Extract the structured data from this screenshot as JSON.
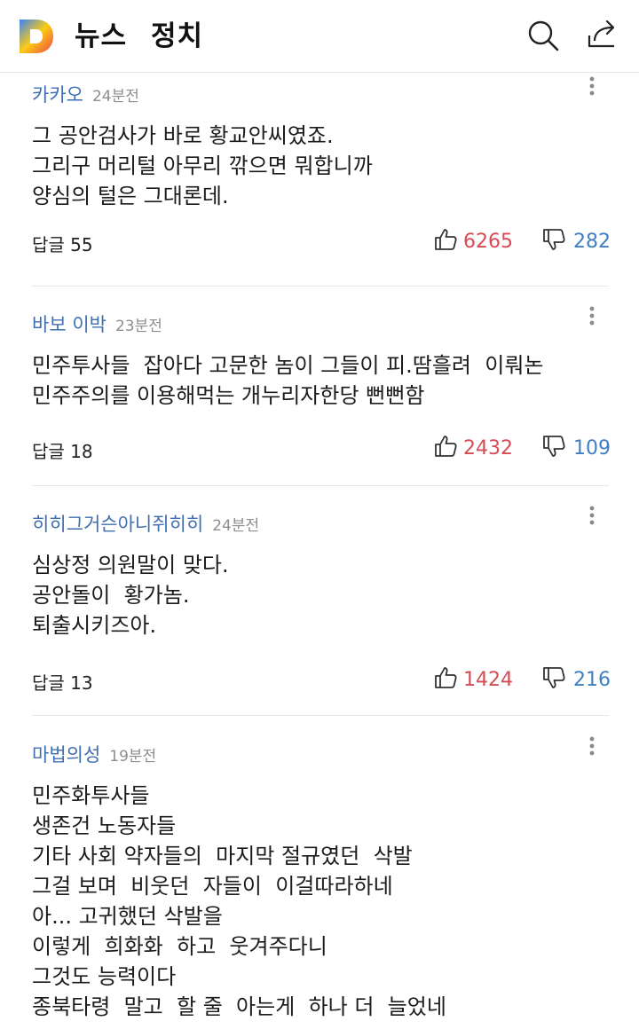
{
  "header": {
    "title": "뉴스",
    "section": "정치",
    "logo_colors": [
      "#3b82f6",
      "#facc15",
      "#ef4444"
    ]
  },
  "comments": [
    {
      "author": "카카오",
      "time": "24분전",
      "lines": [
        "그 공안검사가 바로 황교안씨였죠.",
        "그리구 머리털 아무리 깎으면 뭐합니까",
        "양심의 털은 그대론데."
      ],
      "reply_label": "답글 55",
      "likes": "6265",
      "dislikes": "282"
    },
    {
      "author": "바보 이박",
      "time": "23분전",
      "lines": [
        "민주투사들  잡아다 고문한 놈이 그들이 피.땀흘려  이뤄논",
        "민주주의를 이용해먹는 개누리자한당 뻔뻔함"
      ],
      "reply_label": "답글 18",
      "likes": "2432",
      "dislikes": "109"
    },
    {
      "author": "히히그거슨아니쥐히히",
      "time": "24분전",
      "lines": [
        "심상정 의원말이 맞다.",
        "공안돌이  황가놈.",
        "퇴출시키즈아."
      ],
      "reply_label": "답글 13",
      "likes": "1424",
      "dislikes": "216"
    },
    {
      "author": "마법의성",
      "time": "19분전",
      "lines": [
        "민주화투사들",
        "생존건 노동자들",
        "기타 사회 약자들의  마지막 절규였던  삭발",
        "그걸 보며  비웃던  자들이  이걸따라하네",
        "아... 고귀했던 삭발을",
        "이렇게  희화화  하고  웃겨주다니",
        "그것도 능력이다",
        "종북타령  말고  할 줄  아는게  하나 더  늘었네"
      ]
    }
  ],
  "icons": {
    "search": "search-icon",
    "share": "share-icon",
    "more": "more-vertical-icon",
    "like": "thumbs-up-icon",
    "dislike": "thumbs-down-icon"
  },
  "colors": {
    "author": "#3f6fb0",
    "like_count": "#d54c55",
    "dislike_count": "#3f7fc2",
    "time": "#8e8e8e"
  }
}
